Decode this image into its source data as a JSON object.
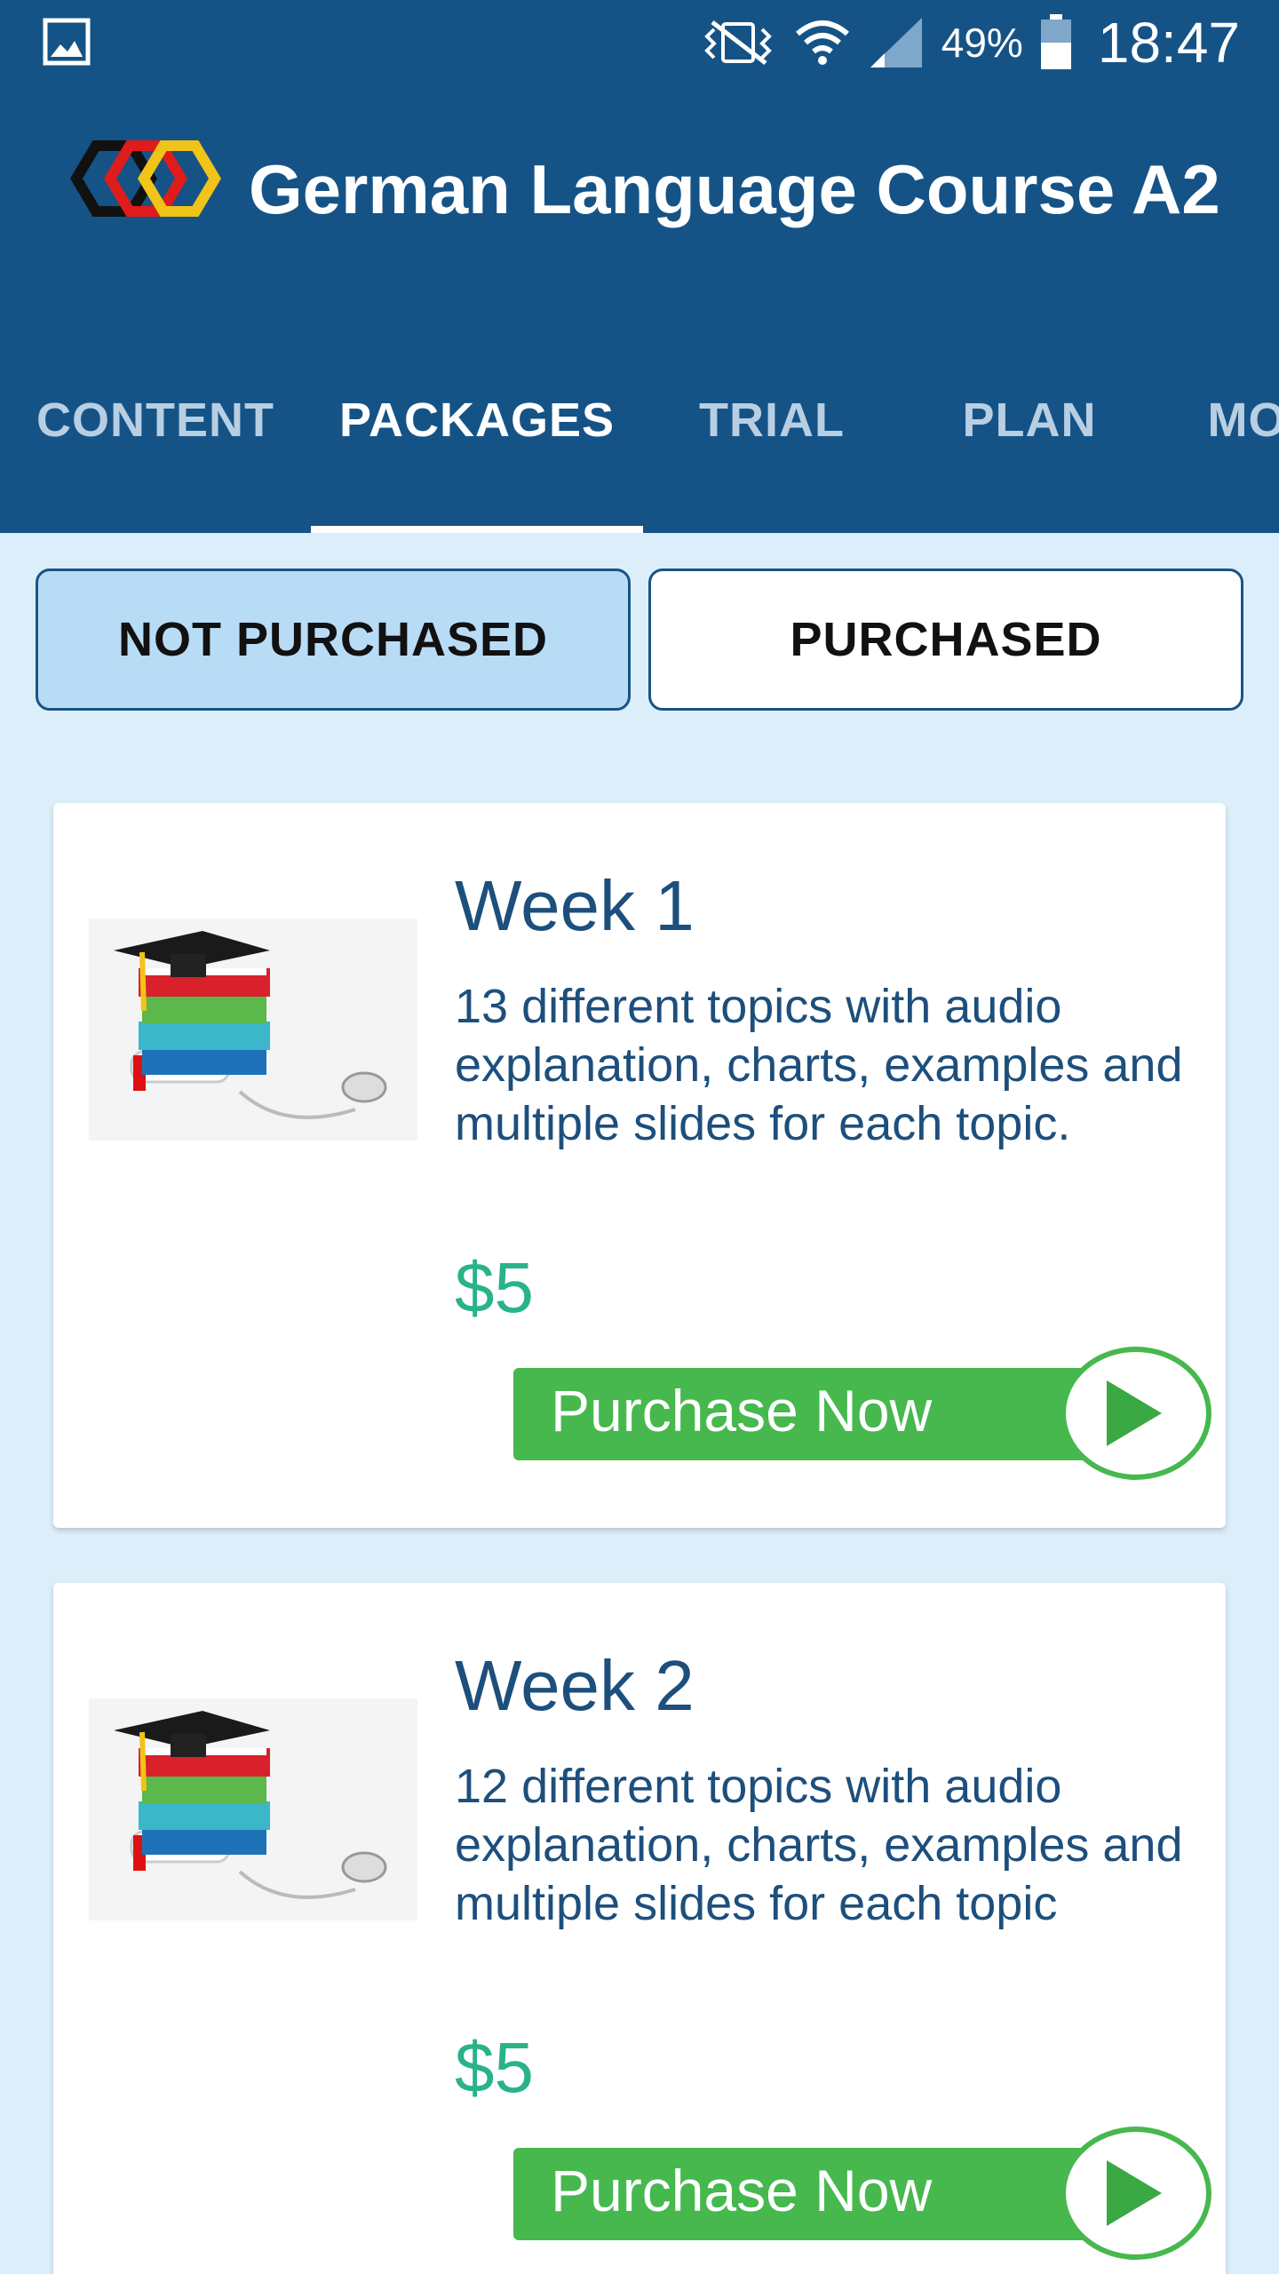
{
  "status_bar": {
    "battery_percent": "49%",
    "time": "18:47",
    "icons": [
      "gallery-icon",
      "vibrate-icon",
      "wifi-icon",
      "signal-icon",
      "battery-icon"
    ]
  },
  "app_bar": {
    "title": "German Language Course A2",
    "logo_icon": "three-hexagon-logo-icon"
  },
  "tabs": [
    {
      "label": "CONTENT",
      "active": false
    },
    {
      "label": "PACKAGES",
      "active": true
    },
    {
      "label": "TRIAL",
      "active": false
    },
    {
      "label": "PLAN",
      "active": false
    },
    {
      "label": "MO",
      "active": false
    }
  ],
  "segments": {
    "not_purchased": "NOT PURCHASED",
    "purchased": "PURCHASED",
    "selected": "not_purchased"
  },
  "packages": [
    {
      "title": "Week 1",
      "description": "13 different topics with audio explanation, charts, examples and multiple slides for each topic.",
      "price": "$5",
      "button_label": "Purchase Now",
      "image_icon": "graduation-books-icon"
    },
    {
      "title": "Week 2",
      "description": "12 different topics with audio explanation, charts, examples and multiple slides for each topic",
      "price": "$5",
      "button_label": "Purchase Now",
      "image_icon": "graduation-books-icon"
    }
  ],
  "colors": {
    "primary": "#155387",
    "background": "#ddeefb",
    "accent_green": "#46b84e",
    "price_green": "#28b38a",
    "text_blue": "#1d4f7d"
  }
}
